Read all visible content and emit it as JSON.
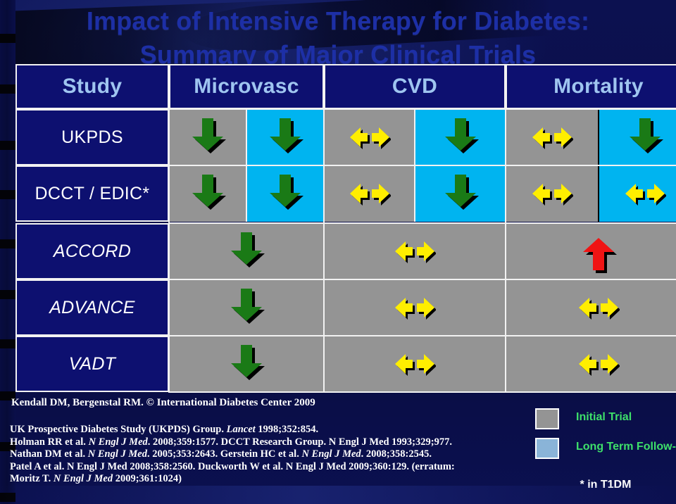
{
  "slide": {
    "title": "Impact of Intensive Therapy for Diabetes:\nSummary of Major Clinical Trials",
    "background_color": "#0a0f4a",
    "title_color": "#1d2fa6"
  },
  "table": {
    "headers": [
      "Study",
      "Microvasc",
      "CVD",
      "Mortality"
    ],
    "header_bg": "#0d1070",
    "header_text_color": "#9fc5f0",
    "initial_trial_color": "#949494",
    "long_term_followup_color": "#00b4f0",
    "rows": [
      {
        "study": "UKPDS",
        "italic": false,
        "split": true,
        "microvasc_initial": "down-arrow-green",
        "microvasc_longterm": "down-arrow-green",
        "cvd_initial": "bidirectional-arrow-yellow",
        "cvd_longterm": "down-arrow-green",
        "mortality_initial": "bidirectional-arrow-yellow",
        "mortality_longterm": "down-arrow-green"
      },
      {
        "study": "DCCT / EDIC*",
        "italic": false,
        "split": true,
        "microvasc_initial": "down-arrow-green",
        "microvasc_longterm": "down-arrow-green",
        "cvd_initial": "bidirectional-arrow-yellow",
        "cvd_longterm": "down-arrow-green",
        "mortality_initial": "bidirectional-arrow-yellow",
        "mortality_longterm": "bidirectional-arrow-yellow"
      },
      {
        "study": "ACCORD",
        "italic": true,
        "split": false,
        "microvasc_initial": "down-arrow-green",
        "cvd_initial": "bidirectional-arrow-yellow",
        "mortality_initial": "up-arrow-red"
      },
      {
        "study": "ADVANCE",
        "italic": true,
        "split": false,
        "microvasc_initial": "down-arrow-green",
        "cvd_initial": "bidirectional-arrow-yellow",
        "mortality_initial": "bidirectional-arrow-yellow"
      },
      {
        "study": "VADT",
        "italic": true,
        "split": false,
        "microvasc_initial": "down-arrow-green",
        "cvd_initial": "bidirectional-arrow-yellow",
        "mortality_initial": "bidirectional-arrow-yellow"
      }
    ]
  },
  "footer": {
    "attribution": "Kendall DM, Bergenstal RM.  © International Diabetes Center 2009",
    "citations": [
      "UK Prospective Diabetes Study (UKPDS) Group. <i>Lancet</i> 1998;352:854.",
      "Holman RR et al. <i>N Engl J Med</i>. 2008;359:1577.  DCCT Research Group. N Engl J Med 1993;329;977.",
      "Nathan DM et al. <i>N Engl J Med</i>. 2005;353:2643.  Gerstein HC et al. <i>N Engl J Med</i>. 2008;358:2545.",
      "Patel A et al. N Engl J Med 2008;358:2560.  Duckworth W et al.  N Engl J Med 2009;360:129. (erratum:",
      "Moritz T. <i>N Engl J Med</i> 2009;361:1024)"
    ],
    "legend": [
      {
        "label": "Initial Trial",
        "color": "#949494"
      },
      {
        "label": "Long Term Follow-up",
        "color": "#8ab4d8"
      }
    ],
    "legend_text_color": "#3ee06a",
    "footnote": "* in T1DM"
  }
}
